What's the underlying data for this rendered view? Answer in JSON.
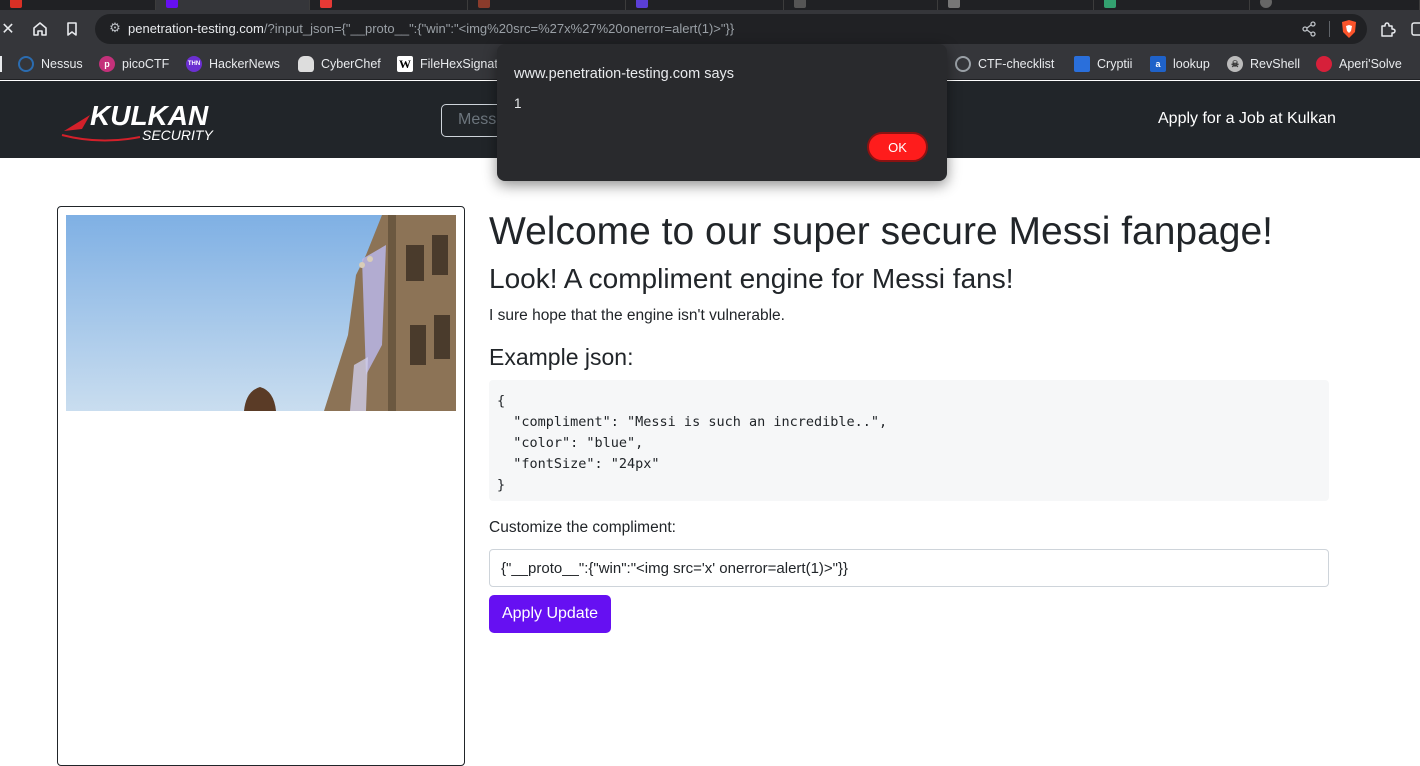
{
  "browser": {
    "url_host": "penetration-testing.com",
    "url_rest": "/?input_json={\"__proto__\":{\"win\":\"<img%20src=%27x%27%20onerror=alert(1)>\"}}",
    "icons": {
      "close": "close-icon",
      "home": "home-icon",
      "bookmark": "bookmark-icon",
      "site_settings": "tune-icon",
      "share": "share-icon",
      "brave": "brave-shield-icon",
      "extensions": "puzzle-icon"
    },
    "bookmarks": [
      {
        "label": "Nessus",
        "icon": "nessus-icon",
        "color": "#1c3e5a"
      },
      {
        "label": "picoCTF",
        "icon": "picoctf-icon",
        "color": "#c3317a"
      },
      {
        "label": "HackerNews",
        "icon": "thn-icon",
        "color": "#6b2fd1"
      },
      {
        "label": "CyberChef",
        "icon": "chef-hat-icon",
        "color": "#dddddd"
      },
      {
        "label": "FileHexSignat",
        "icon": "wikipedia-icon",
        "color": "#ffffff"
      },
      {
        "label": "CTF-checklist",
        "icon": "github-icon",
        "color": "#333333"
      },
      {
        "label": "Cryptii",
        "icon": "cryptii-icon",
        "color": "#2a6fdb"
      },
      {
        "label": "lookup",
        "icon": "lookup-icon",
        "color": "#1f62c9"
      },
      {
        "label": "RevShell",
        "icon": "skull-icon",
        "color": "#bbbbbb"
      },
      {
        "label": "Aperi'Solve",
        "icon": "aperisolve-icon",
        "color": "#d6203a"
      }
    ]
  },
  "navbar": {
    "brand_name": "KULKAN",
    "brand_sub": "SECURITY",
    "search_placeholder": "Mess",
    "link_label": "Apply for a Job at Kulkan"
  },
  "main": {
    "title": "Welcome to our super secure Messi fanpage!",
    "subtitle": "Look! A compliment engine for Messi fans!",
    "lead": "I sure hope that the engine isn't vulnerable.",
    "example_heading": "Example json:",
    "example_lines": [
      "{",
      "  \"compliment\": \"Messi is such an incredible..\",",
      "  \"color\": \"blue\",",
      "  \"fontSize\": \"24px\"",
      "}"
    ],
    "input_label": "Customize the compliment:",
    "input_value": "{\"__proto__\":{\"win\":\"<img src='x' onerror=alert(1)>\"}}",
    "button_label": "Apply Update"
  },
  "dialog": {
    "origin": "www.penetration-testing.com says",
    "message": "1",
    "ok_label": "OK"
  },
  "colors": {
    "navbar_bg": "#212529",
    "button_primary": "#6610f2",
    "dialog_ok": "#fe1c1c",
    "code_bg": "#f6f7f8"
  }
}
